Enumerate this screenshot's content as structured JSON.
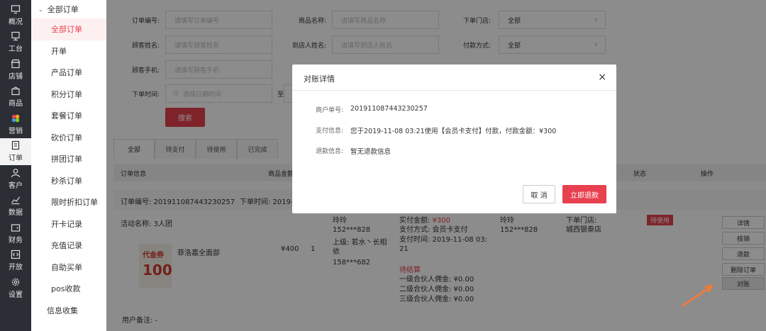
{
  "rail": [
    {
      "label": "概况",
      "icon": "monitor-icon"
    },
    {
      "label": "工台",
      "icon": "desktop-icon"
    },
    {
      "label": "店铺",
      "icon": "store-icon"
    },
    {
      "label": "商品",
      "icon": "bag-icon"
    },
    {
      "label": "营销",
      "icon": "flower-icon"
    },
    {
      "label": "订单",
      "icon": "order-icon",
      "active": true
    },
    {
      "label": "客户",
      "icon": "user-icon"
    },
    {
      "label": "数据",
      "icon": "chart-icon"
    },
    {
      "label": "财务",
      "icon": "wallet-icon"
    },
    {
      "label": "开放",
      "icon": "code-icon"
    },
    {
      "label": "设置",
      "icon": "gear-icon"
    }
  ],
  "submenu": {
    "group": "全部订单",
    "items": [
      "全部订单",
      "开单",
      "产品订单",
      "积分订单",
      "套餐订单",
      "砍价订单",
      "拼团订单",
      "秒杀订单",
      "限时折扣订单",
      "开卡记录",
      "充值记录",
      "自助买单",
      "pos收款"
    ],
    "bottom": "信息收集"
  },
  "filters": {
    "order_no_label": "订单编号:",
    "order_no_ph": "请填写订单编号",
    "product_label": "商品名称:",
    "product_ph": "请填写商品名称",
    "store_label": "下单门店:",
    "store_value": "全部",
    "customer_label": "顾客姓名:",
    "customer_ph": "请填写顾客姓名",
    "visitor_label": "到店人姓名:",
    "visitor_ph": "请填写到店人姓名",
    "pay_label": "付款方式:",
    "pay_value": "全部",
    "phone_label": "顾客手机:",
    "phone_ph": "请填写顾客手机",
    "time_label": "下单时间:",
    "time_ph": "选择日期时间",
    "to_label": "至",
    "search_btn": "搜索"
  },
  "tabs": [
    "全部",
    "待支付",
    "待使用",
    "已完成"
  ],
  "table": {
    "headers": {
      "info": "订单信息",
      "amount": "商品金额",
      "status": "状态",
      "ops": "操作"
    }
  },
  "order": {
    "no": "订单编号: 201911087443230257",
    "time": "下单时间: 2019-",
    "activity": "活动名称: 3人团",
    "voucher_t1": "代金券",
    "voucher_t2": "100",
    "product": "菲洛嘉全面部",
    "price": "¥400",
    "qty": "1",
    "buyer_name": "玲玲",
    "buyer_phone": "152***828",
    "upline_label": "上级: 若水丶长相",
    "upline_suffix": "依",
    "upline_phone": "158***682",
    "paid_label": "实付金额: ",
    "paid_value": "¥300",
    "pay_method": "支付方式: 会员卡支付",
    "pay_time": "支付时间: 2019-11-08 03:",
    "pay_time2": "21",
    "settle": "待结算",
    "c1": "一级合伙人佣金: ¥0.00",
    "c2": "二级合伙人佣金: ¥0.00",
    "c3": "三级合伙人佣金: ¥0.00",
    "visitor_name": "玲玲",
    "visitor_phone": "152***828",
    "store_label": "下单门店:",
    "store_name": "城西银泰店",
    "status": "待使用",
    "ops": [
      "详情",
      "核销",
      "退款",
      "删除订单",
      "对账"
    ],
    "remark": "用户备注: -"
  },
  "modal": {
    "title": "对账详情",
    "close": "×",
    "merchant_label": "商户单号:",
    "merchant_value": "201911087443230257",
    "payinfo_label": "支付信息:",
    "payinfo_value": "您于2019-11-08 03:21使用【会员卡支付】付款，付款金额：¥300",
    "refund_label": "退款信息:",
    "refund_value": "暂无退款信息",
    "cancel": "取 消",
    "refund": "立即退款"
  },
  "colors": {
    "accent": "#e8404f",
    "rail": "#2b2e34"
  }
}
